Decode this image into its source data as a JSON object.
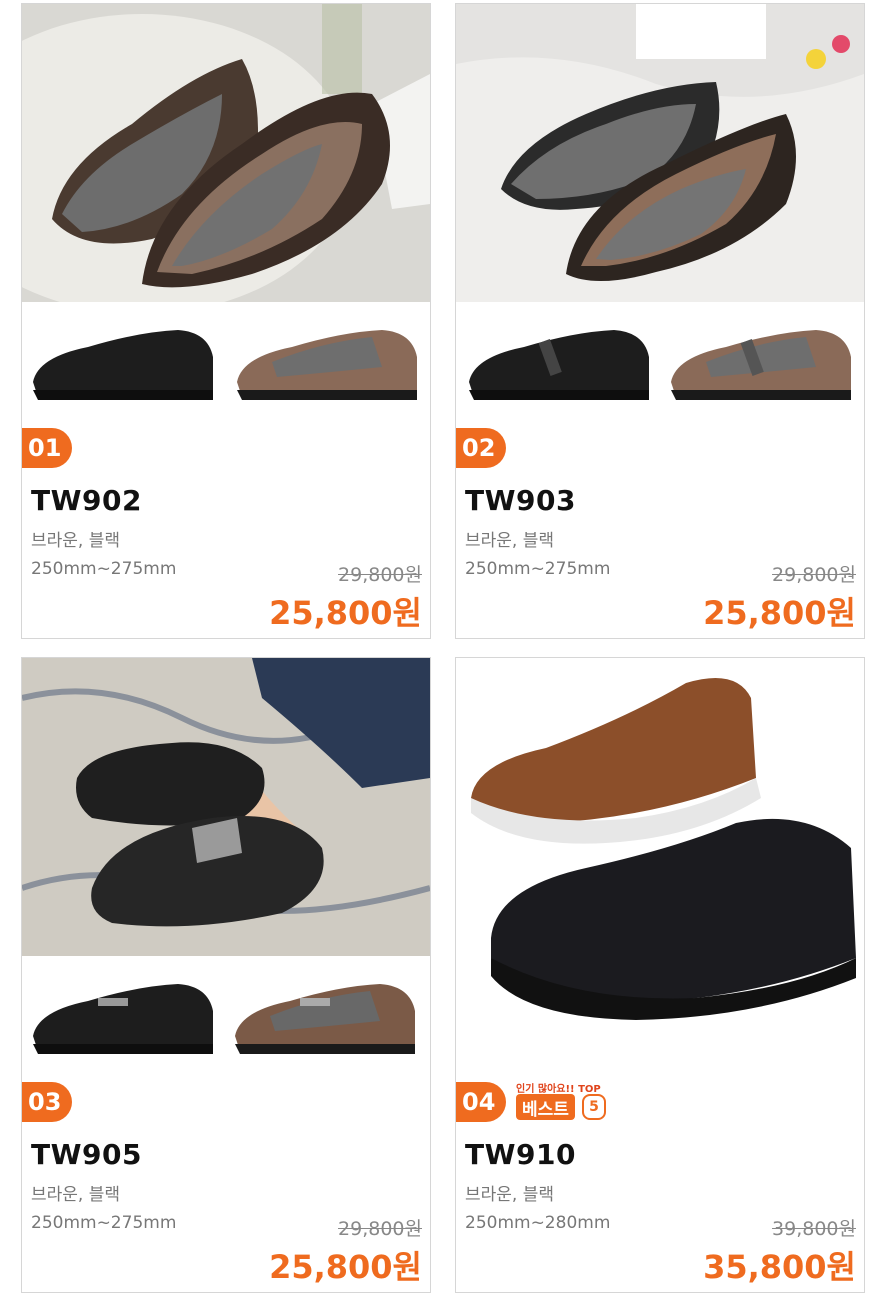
{
  "products": [
    {
      "num": "01",
      "model": "TW902",
      "colors": "브라운, 블랙",
      "size": "250mm~275mm",
      "old_price": "29,800원",
      "price": "25,800원"
    },
    {
      "num": "02",
      "model": "TW903",
      "colors": "브라운, 블랙",
      "size": "250mm~275mm",
      "old_price": "29,800원",
      "price": "25,800원"
    },
    {
      "num": "03",
      "model": "TW905",
      "colors": "브라운, 블랙",
      "size": "250mm~275mm",
      "old_price": "29,800원",
      "price": "25,800원"
    },
    {
      "num": "04",
      "model": "TW910",
      "colors": "브라운, 블랙",
      "size": "250mm~280mm",
      "old_price": "39,800원",
      "price": "35,800원",
      "badge": {
        "small": "인기 많아요!! TOP",
        "big": "베스트",
        "rank": "5"
      }
    }
  ],
  "accent_color": "#ef6b1f"
}
